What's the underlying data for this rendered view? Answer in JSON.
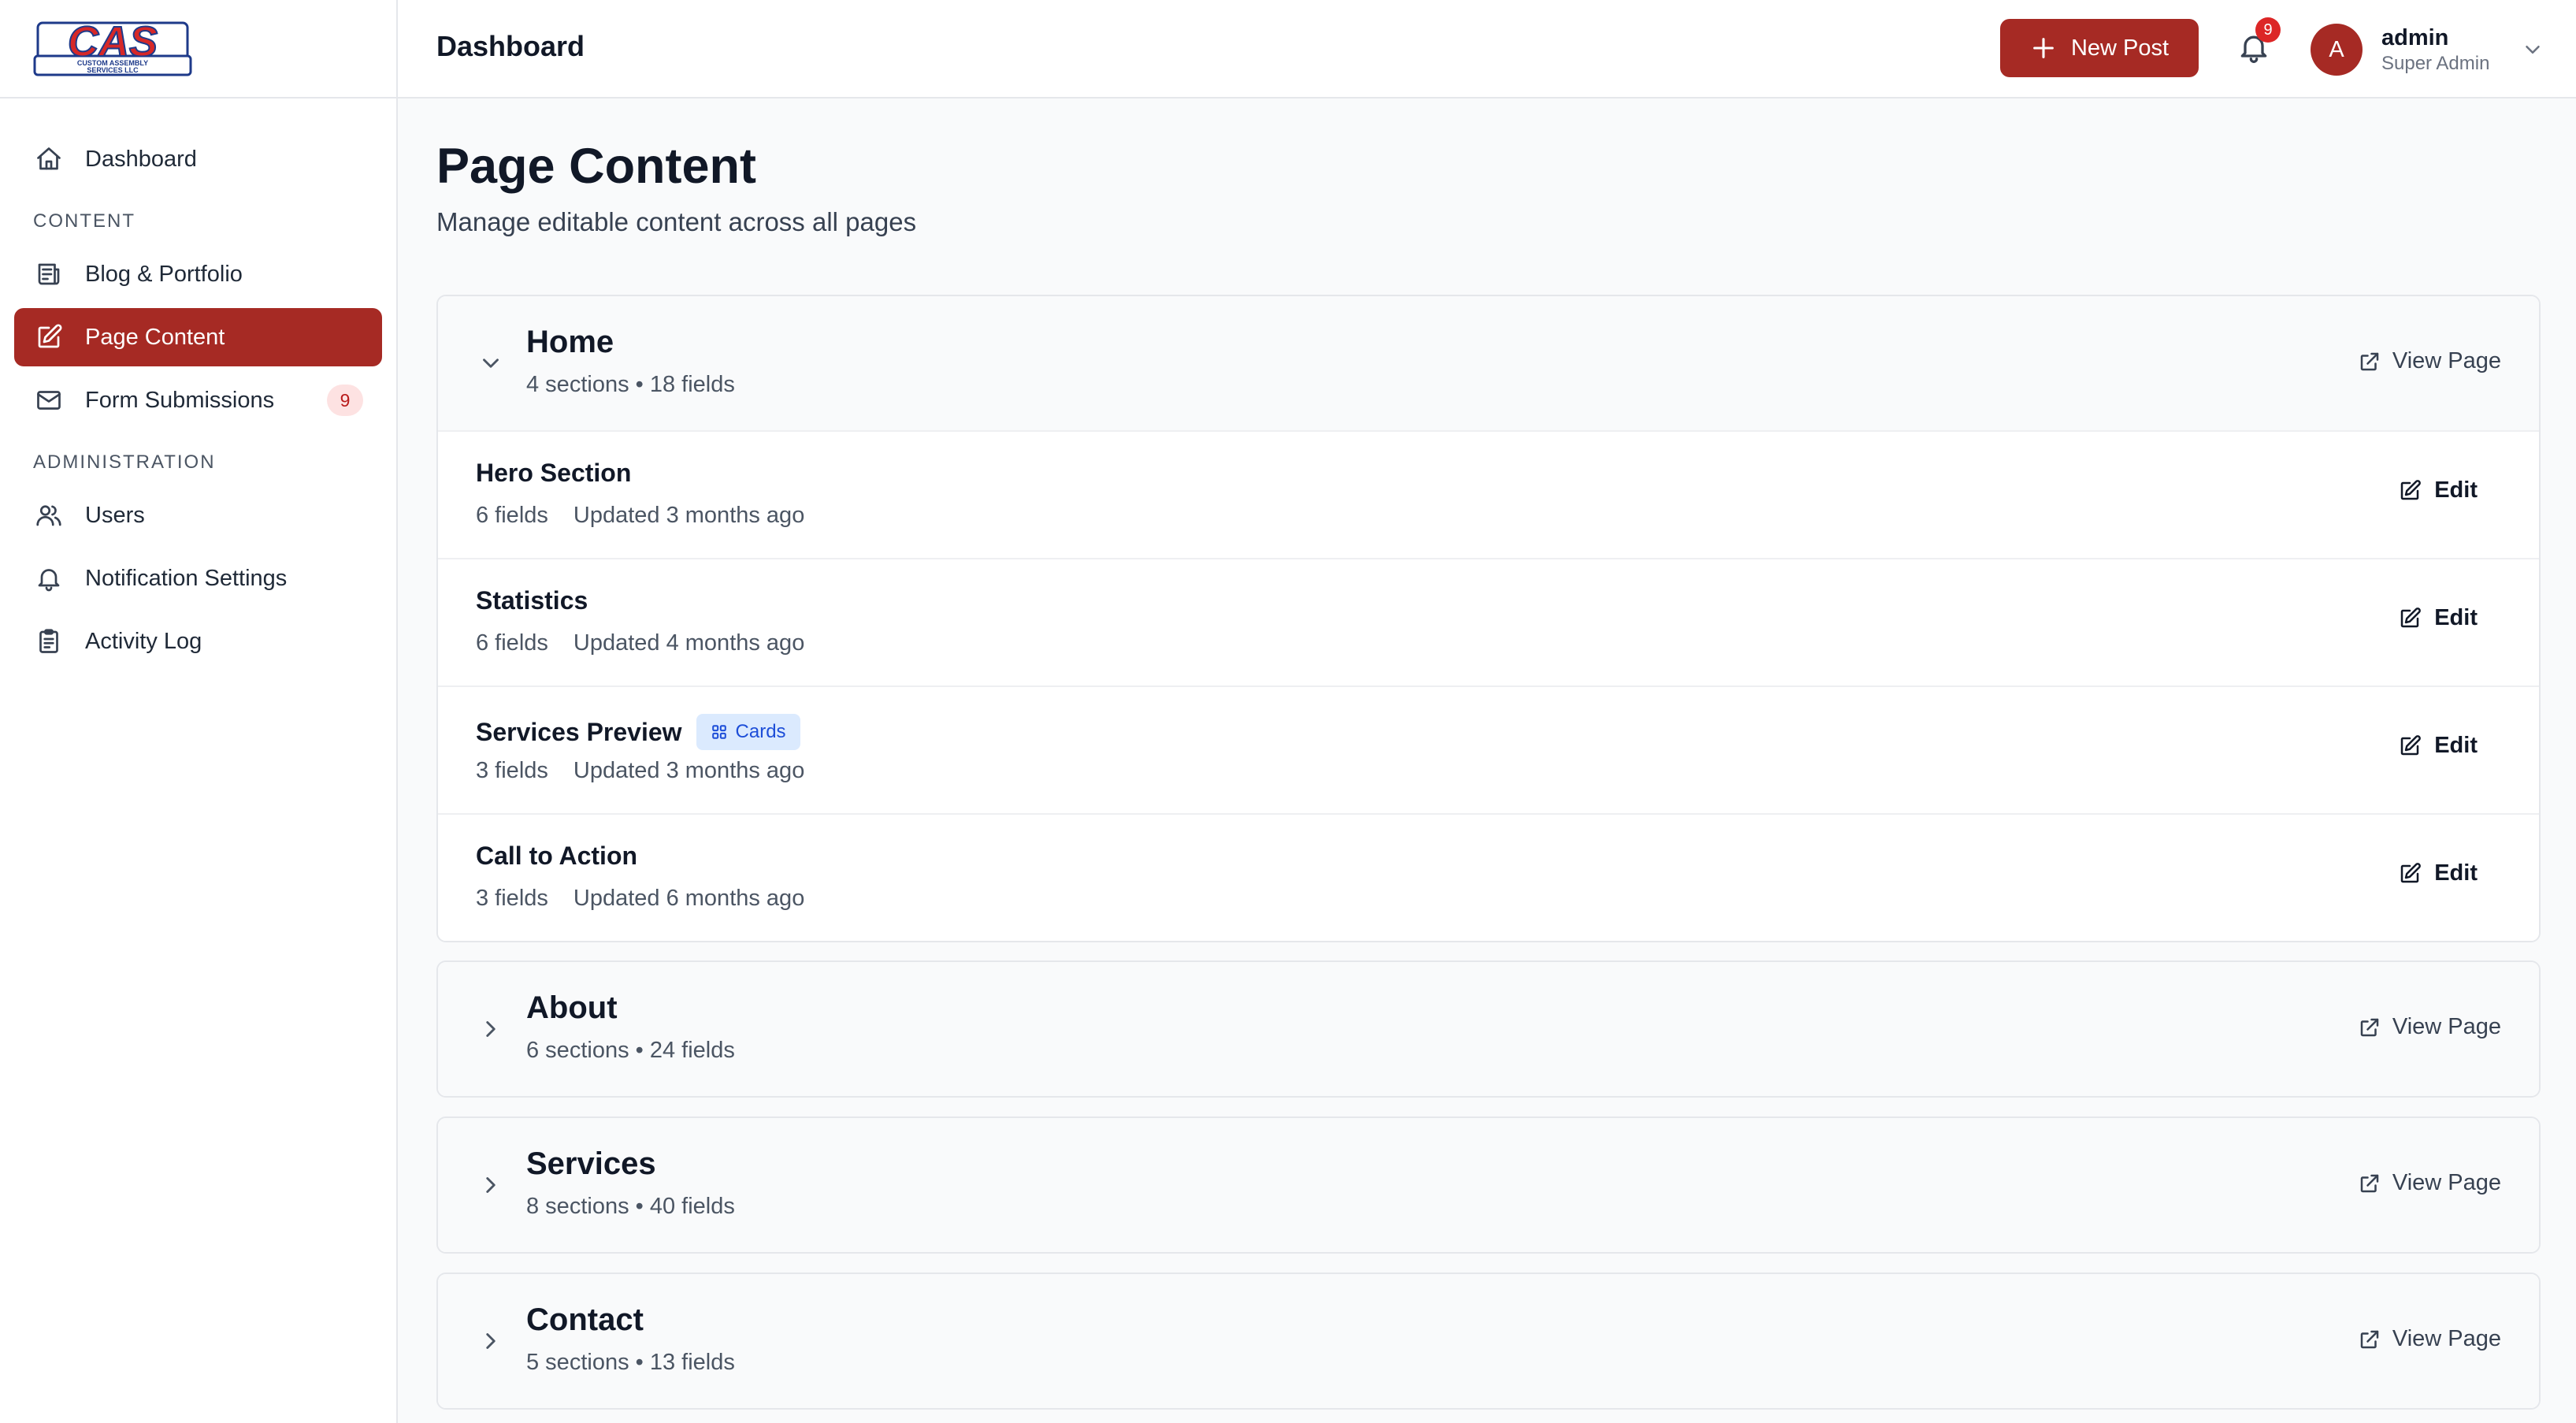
{
  "brand": {
    "logo_text": "CAS",
    "logo_subtext_1": "CUSTOM ASSEMBLY",
    "logo_subtext_2": "SERVICES LLC"
  },
  "sidebar": {
    "dashboard": {
      "label": "Dashboard",
      "icon": "home-icon"
    },
    "content_heading": "CONTENT",
    "content_items": [
      {
        "label": "Blog & Portfolio",
        "icon": "newspaper-icon"
      },
      {
        "label": "Page Content",
        "icon": "pencil-square-icon",
        "active": true
      },
      {
        "label": "Form Submissions",
        "icon": "envelope-icon",
        "badge": "9"
      }
    ],
    "admin_heading": "ADMINISTRATION",
    "admin_items": [
      {
        "label": "Users",
        "icon": "users-icon"
      },
      {
        "label": "Notification Settings",
        "icon": "bell-icon"
      },
      {
        "label": "Activity Log",
        "icon": "clipboard-icon"
      }
    ]
  },
  "header": {
    "title": "Dashboard",
    "new_post_label": "New Post",
    "notification_count": "9",
    "user": {
      "initial": "A",
      "name": "admin",
      "role": "Super Admin"
    }
  },
  "main": {
    "title": "Page Content",
    "subtitle": "Manage editable content across all pages",
    "view_page_label": "View Page",
    "edit_label": "Edit",
    "pages": [
      {
        "title": "Home",
        "meta": "4 sections • 18 fields",
        "expanded": true,
        "sections": [
          {
            "title": "Hero Section",
            "fields": "6 fields",
            "updated": "Updated 3 months ago"
          },
          {
            "title": "Statistics",
            "fields": "6 fields",
            "updated": "Updated 4 months ago"
          },
          {
            "title": "Services Preview",
            "tag": "Cards",
            "fields": "3 fields",
            "updated": "Updated 3 months ago"
          },
          {
            "title": "Call to Action",
            "fields": "3 fields",
            "updated": "Updated 6 months ago"
          }
        ]
      },
      {
        "title": "About",
        "meta": "6 sections • 24 fields",
        "expanded": false
      },
      {
        "title": "Services",
        "meta": "8 sections • 40 fields",
        "expanded": false
      },
      {
        "title": "Contact",
        "meta": "5 sections • 13 fields",
        "expanded": false
      }
    ]
  },
  "colors": {
    "accent": "#a62a24",
    "badge_bg": "#fde2e2",
    "tag_bg": "#dbeafe",
    "tag_text": "#1d4ed8"
  }
}
